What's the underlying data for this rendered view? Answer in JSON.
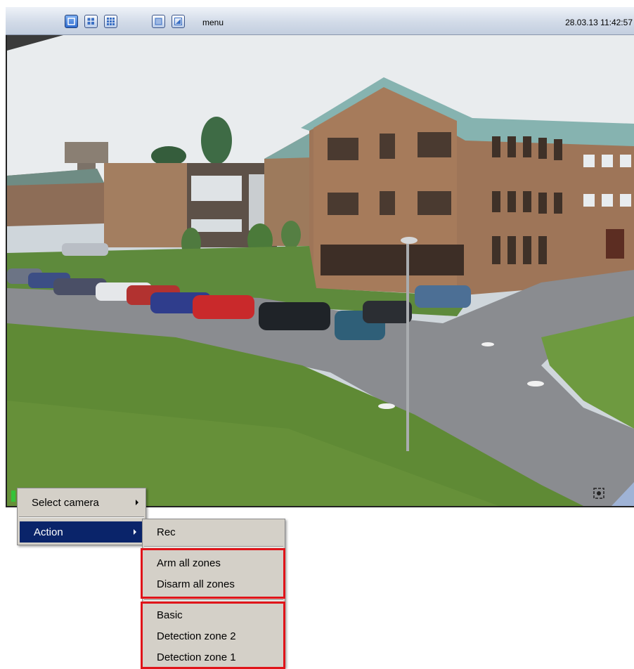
{
  "toolbar": {
    "layout_buttons": [
      {
        "icon": "layout-1x1-icon",
        "active": true
      },
      {
        "icon": "layout-2x2-icon",
        "active": false
      },
      {
        "icon": "layout-3x3-icon",
        "active": false
      }
    ],
    "view_buttons": [
      {
        "icon": "fullscreen-icon"
      },
      {
        "icon": "snapshot-icon"
      }
    ],
    "menu_label": "menu",
    "datetime": "28.03.13 11:42:57"
  },
  "camera": {
    "scene": "parking-lot-campus-view"
  },
  "context_menu": {
    "items": [
      {
        "label": "Select camera",
        "has_submenu": true,
        "selected": false
      },
      {
        "label": "Action",
        "has_submenu": true,
        "selected": true
      }
    ]
  },
  "action_submenu": {
    "rec_label": "Rec",
    "zone_group": [
      "Arm all zones",
      "Disarm all zones"
    ],
    "detection_group": [
      "Basic",
      "Detection zone 2",
      "Detection zone 1"
    ]
  },
  "colors": {
    "menu_highlight": "#0a246a",
    "menu_background": "#d4d0c8",
    "annotation_red": "#e0141a",
    "toolbar_active": "#2f6ccf"
  }
}
